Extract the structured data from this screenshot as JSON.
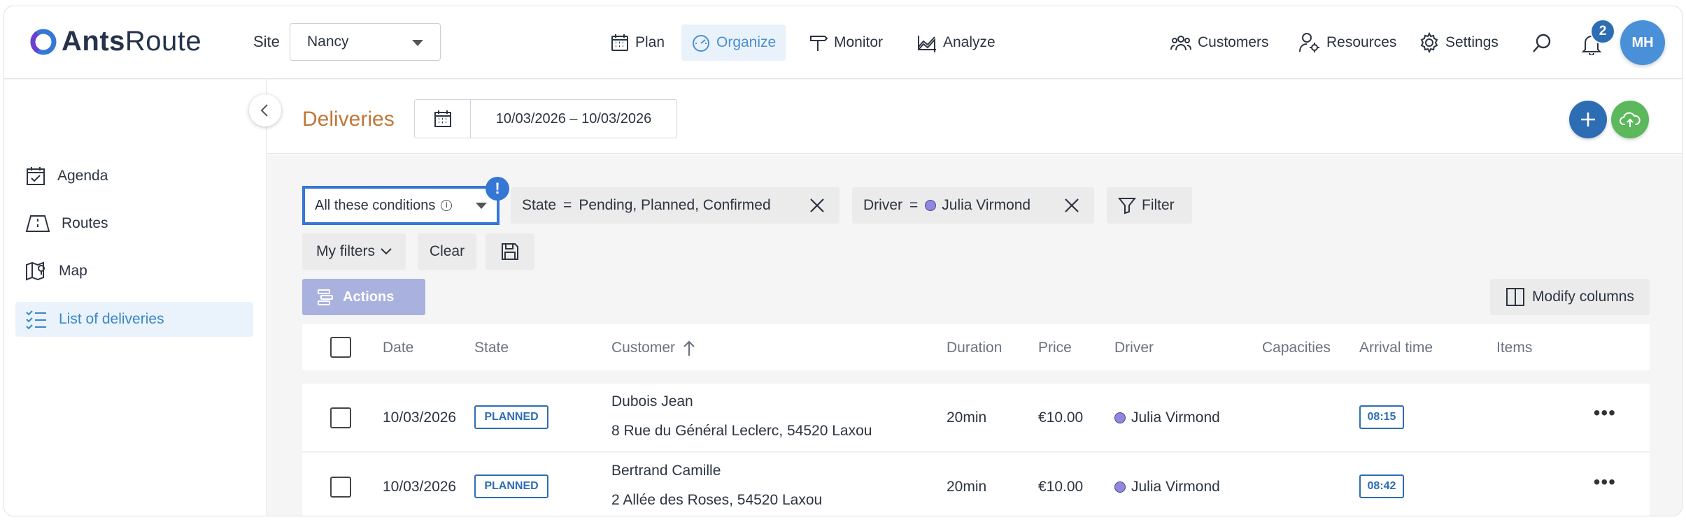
{
  "header": {
    "logo_text_bold": "Ants",
    "logo_text_regular": "Route",
    "site_label": "Site",
    "site_value": "Nancy",
    "nav": [
      {
        "label": "Plan",
        "icon": "calendar-grid-icon"
      },
      {
        "label": "Organize",
        "icon": "speedometer-icon",
        "active": true
      },
      {
        "label": "Monitor",
        "icon": "signpost-icon"
      },
      {
        "label": "Analyze",
        "icon": "chart-icon"
      }
    ],
    "right_nav": [
      {
        "label": "Customers",
        "icon": "people-icon"
      },
      {
        "label": "Resources",
        "icon": "user-gear-icon"
      },
      {
        "label": "Settings",
        "icon": "gear-icon"
      }
    ],
    "notification_count": "2",
    "avatar_initials": "MH"
  },
  "sidebar": {
    "items": [
      {
        "label": "Agenda",
        "icon": "calendar-check-icon"
      },
      {
        "label": "Routes",
        "icon": "road-icon"
      },
      {
        "label": "Map",
        "icon": "map-pin-icon"
      },
      {
        "label": "List of deliveries",
        "icon": "list-check-icon",
        "active": true
      }
    ]
  },
  "main": {
    "title": "Deliveries",
    "date_range": "10/03/2026 – 10/03/2026",
    "filters": {
      "condition_mode": "All these conditions",
      "warning_mark": "!",
      "chips": [
        {
          "field": "State",
          "operator": "=",
          "value": "Pending, Planned, Confirmed"
        },
        {
          "field": "Driver",
          "operator": "=",
          "value": "Julia Virmond"
        }
      ],
      "filter_label": "Filter",
      "my_filters_label": "My filters",
      "clear_label": "Clear"
    },
    "actions_label": "Actions",
    "modify_columns_label": "Modify columns",
    "columns": [
      "Date",
      "State",
      "Customer",
      "Duration",
      "Price",
      "Driver",
      "Capacities",
      "Arrival time",
      "Items"
    ],
    "rows": [
      {
        "date": "10/03/2026",
        "state": "PLANNED",
        "customer_name": "Dubois Jean",
        "customer_address": "8 Rue du Général Leclerc, 54520 Laxou",
        "duration": "20min",
        "price": "€10.00",
        "driver": "Julia Virmond",
        "arrival": "08:15"
      },
      {
        "date": "10/03/2026",
        "state": "PLANNED",
        "customer_name": "Bertrand Camille",
        "customer_address": "2 Allée des Roses, 54520 Laxou",
        "duration": "20min",
        "price": "€10.00",
        "driver": "Julia Virmond",
        "arrival": "08:42"
      }
    ]
  },
  "colors": {
    "accent": "#3577d4",
    "title": "#c0773a",
    "add_button": "#2d6db3",
    "upload_button": "#5cb85c",
    "actions_disabled": "#a9b2de"
  }
}
